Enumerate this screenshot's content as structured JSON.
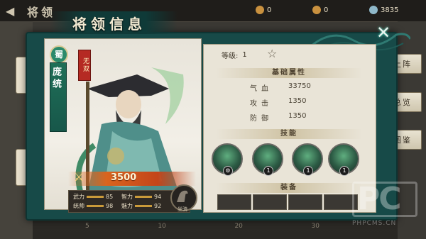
{
  "background_screen": {
    "title": "将领",
    "resources": [
      "0",
      "0",
      "3835"
    ],
    "right_buttons": [
      "上阵",
      "总览",
      "图鉴"
    ],
    "bottom_numbers": [
      "5",
      "10",
      "20",
      "30"
    ],
    "watermark": {
      "logo": "PC",
      "site": "PHPCMS.CN"
    }
  },
  "dialog": {
    "title": "将领信息",
    "close_icon": "close-x-icon",
    "hero": {
      "faction": "蜀",
      "name": "庞统",
      "rank_tag": "无双",
      "power": "3500",
      "stats": [
        {
          "label": "武力",
          "value": "85"
        },
        {
          "label": "智力",
          "value": "94"
        },
        {
          "label": "统帅",
          "value": "98"
        },
        {
          "label": "魅力",
          "value": "92"
        }
      ],
      "mount_label": "坐骑"
    },
    "info": {
      "level_label": "等级:",
      "level_value": "1",
      "star_icon": "star-icon",
      "basic_attrs_title": "基础属性",
      "attrs": [
        {
          "label": "气血",
          "value": "33750"
        },
        {
          "label": "攻击",
          "value": "1350"
        },
        {
          "label": "防御",
          "value": "1350"
        }
      ],
      "skills_title": "技能",
      "skills": [
        {
          "level": ""
        },
        {
          "level": "1"
        },
        {
          "level": "1"
        },
        {
          "level": "1"
        }
      ],
      "equipment_title": "装备",
      "equipment_slots": 4
    }
  },
  "colors": {
    "dialog_teal": "#174a48",
    "panel_bg": "#e9e4d7",
    "power_orange": "#d9641e",
    "rank_red": "#b52a23",
    "faction_green": "#2b8a6b"
  }
}
